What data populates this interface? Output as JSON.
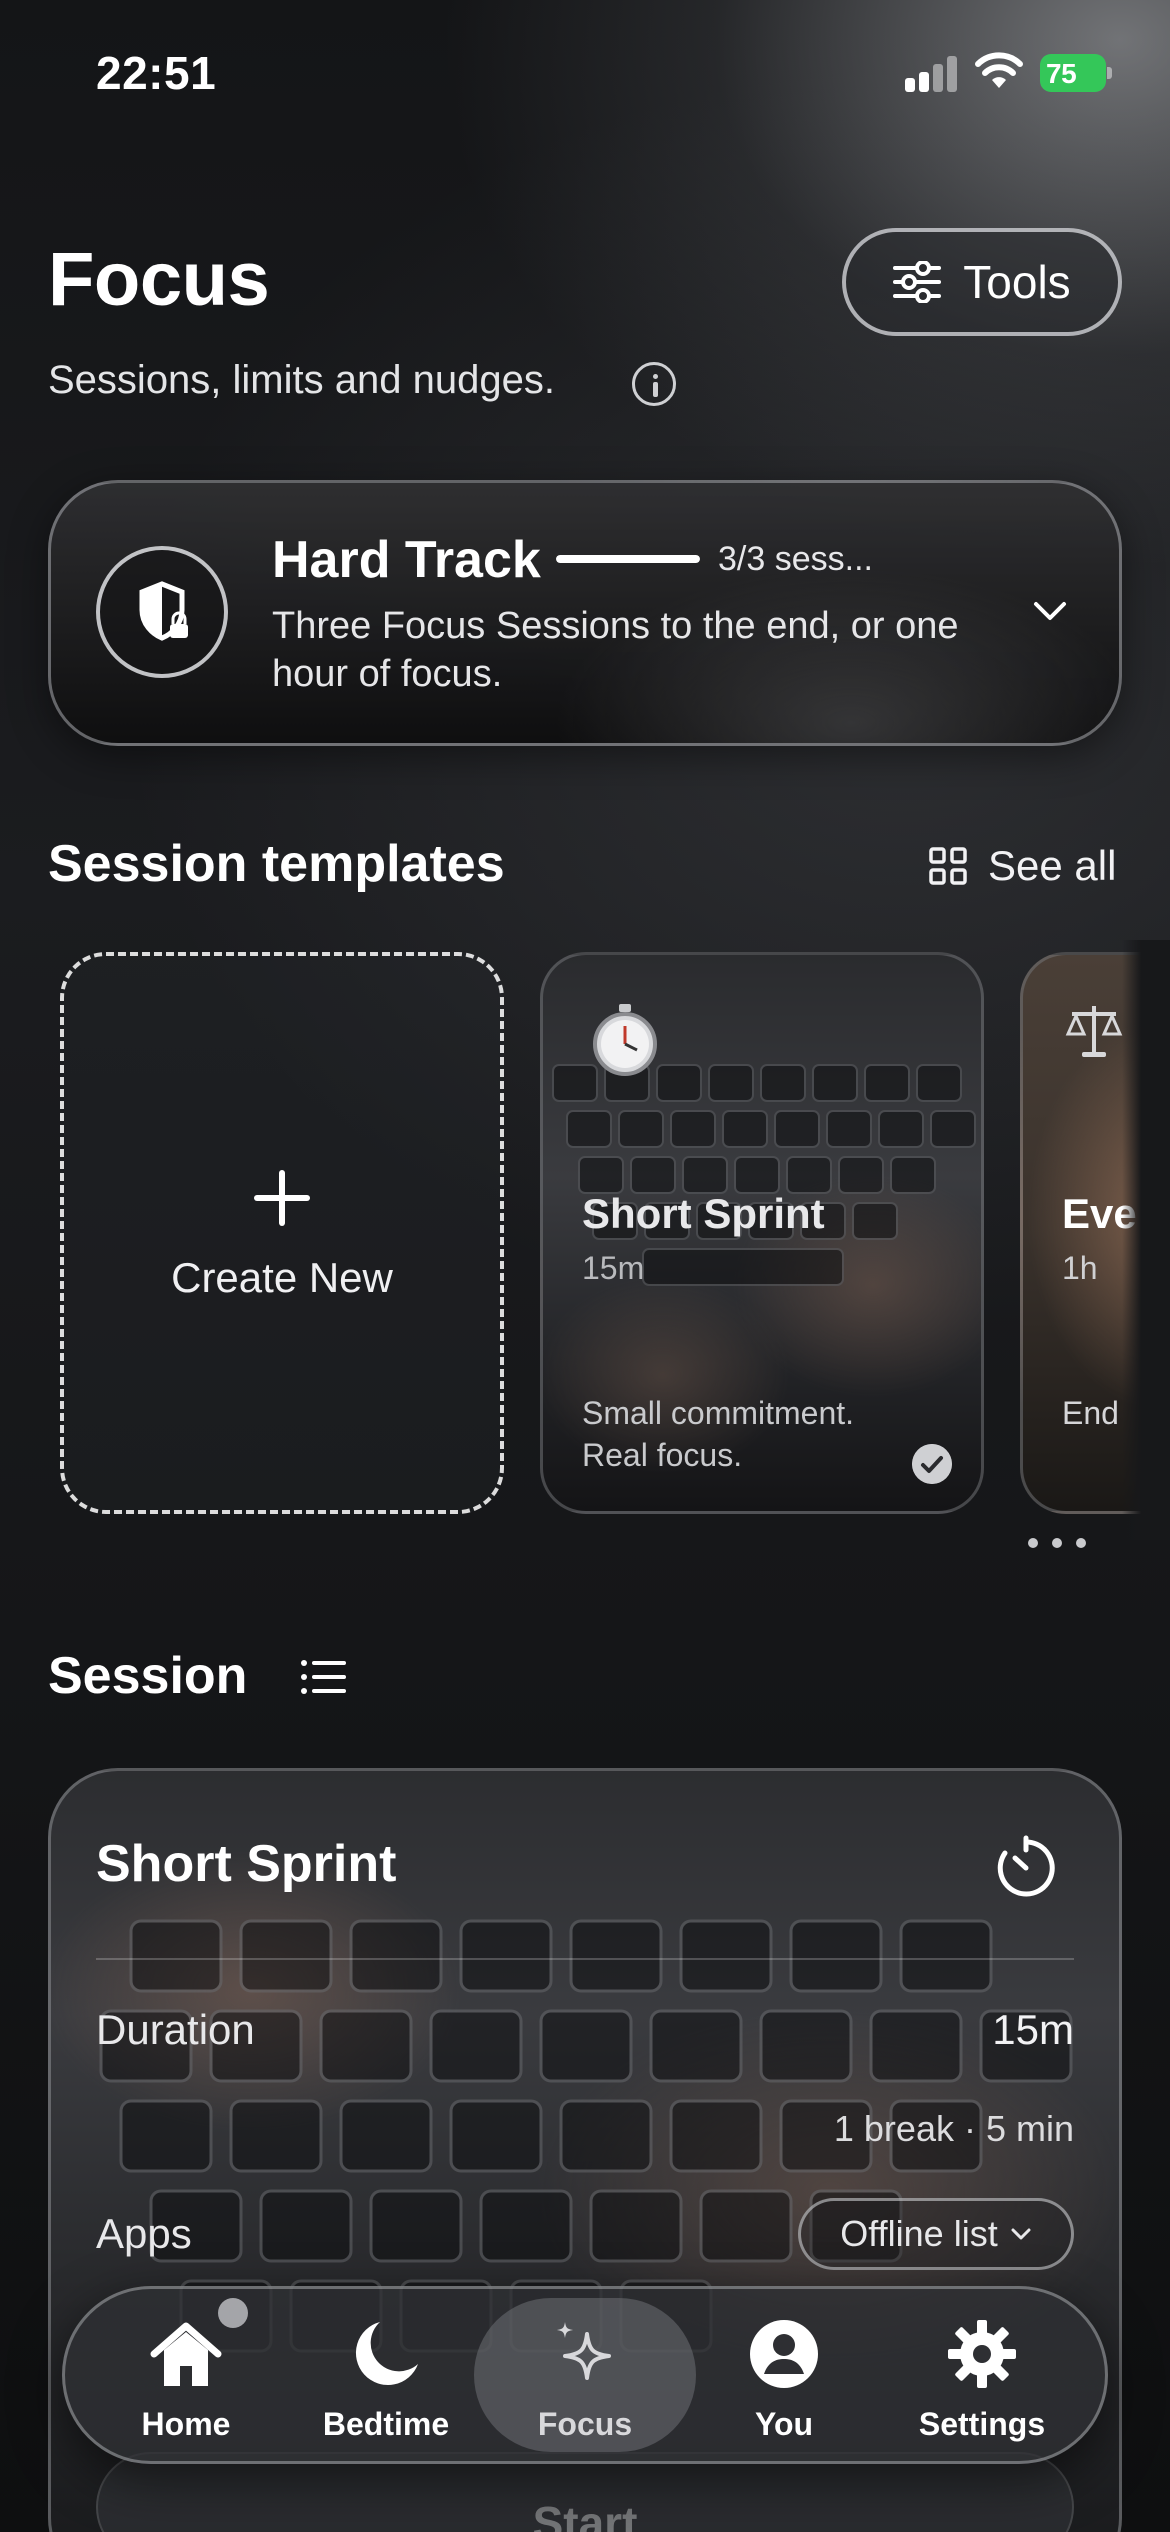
{
  "status_bar": {
    "time": "22:51",
    "battery": "75"
  },
  "header": {
    "title": "Focus",
    "subtitle": "Sessions, limits and nudges.",
    "tools_label": "Tools"
  },
  "hard_track": {
    "title": "Hard Track",
    "progress_fraction": 1.0,
    "count_text": "3/3 sess...",
    "description": "Three Focus Sessions to the end, or one hour of focus."
  },
  "templates": {
    "heading": "Session templates",
    "see_all": "See all",
    "create_label": "Create New",
    "cards": [
      {
        "name": "Short Sprint",
        "duration": "15m",
        "description": "Small commitment. Real focus.",
        "icon": "stopwatch-icon",
        "selected": true
      },
      {
        "name": "Eve",
        "duration": "1h",
        "description": "End sess",
        "icon": "scale-icon",
        "selected": false
      }
    ]
  },
  "session": {
    "heading": "Session",
    "name": "Short Sprint",
    "duration_label": "Duration",
    "duration_value": "15m",
    "break_value": "1 break · 5 min",
    "apps_label": "Apps",
    "apps_value": "Offline list",
    "start_label": "Start"
  },
  "tab_bar": {
    "active": "Focus",
    "items": [
      {
        "label": "Home",
        "icon": "home-icon"
      },
      {
        "label": "Bedtime",
        "icon": "moon-icon"
      },
      {
        "label": "Focus",
        "icon": "sparkles-icon"
      },
      {
        "label": "You",
        "icon": "person-icon"
      },
      {
        "label": "Settings",
        "icon": "gear-icon"
      }
    ]
  },
  "colors": {
    "battery": "#34c759",
    "background": "#131416"
  }
}
